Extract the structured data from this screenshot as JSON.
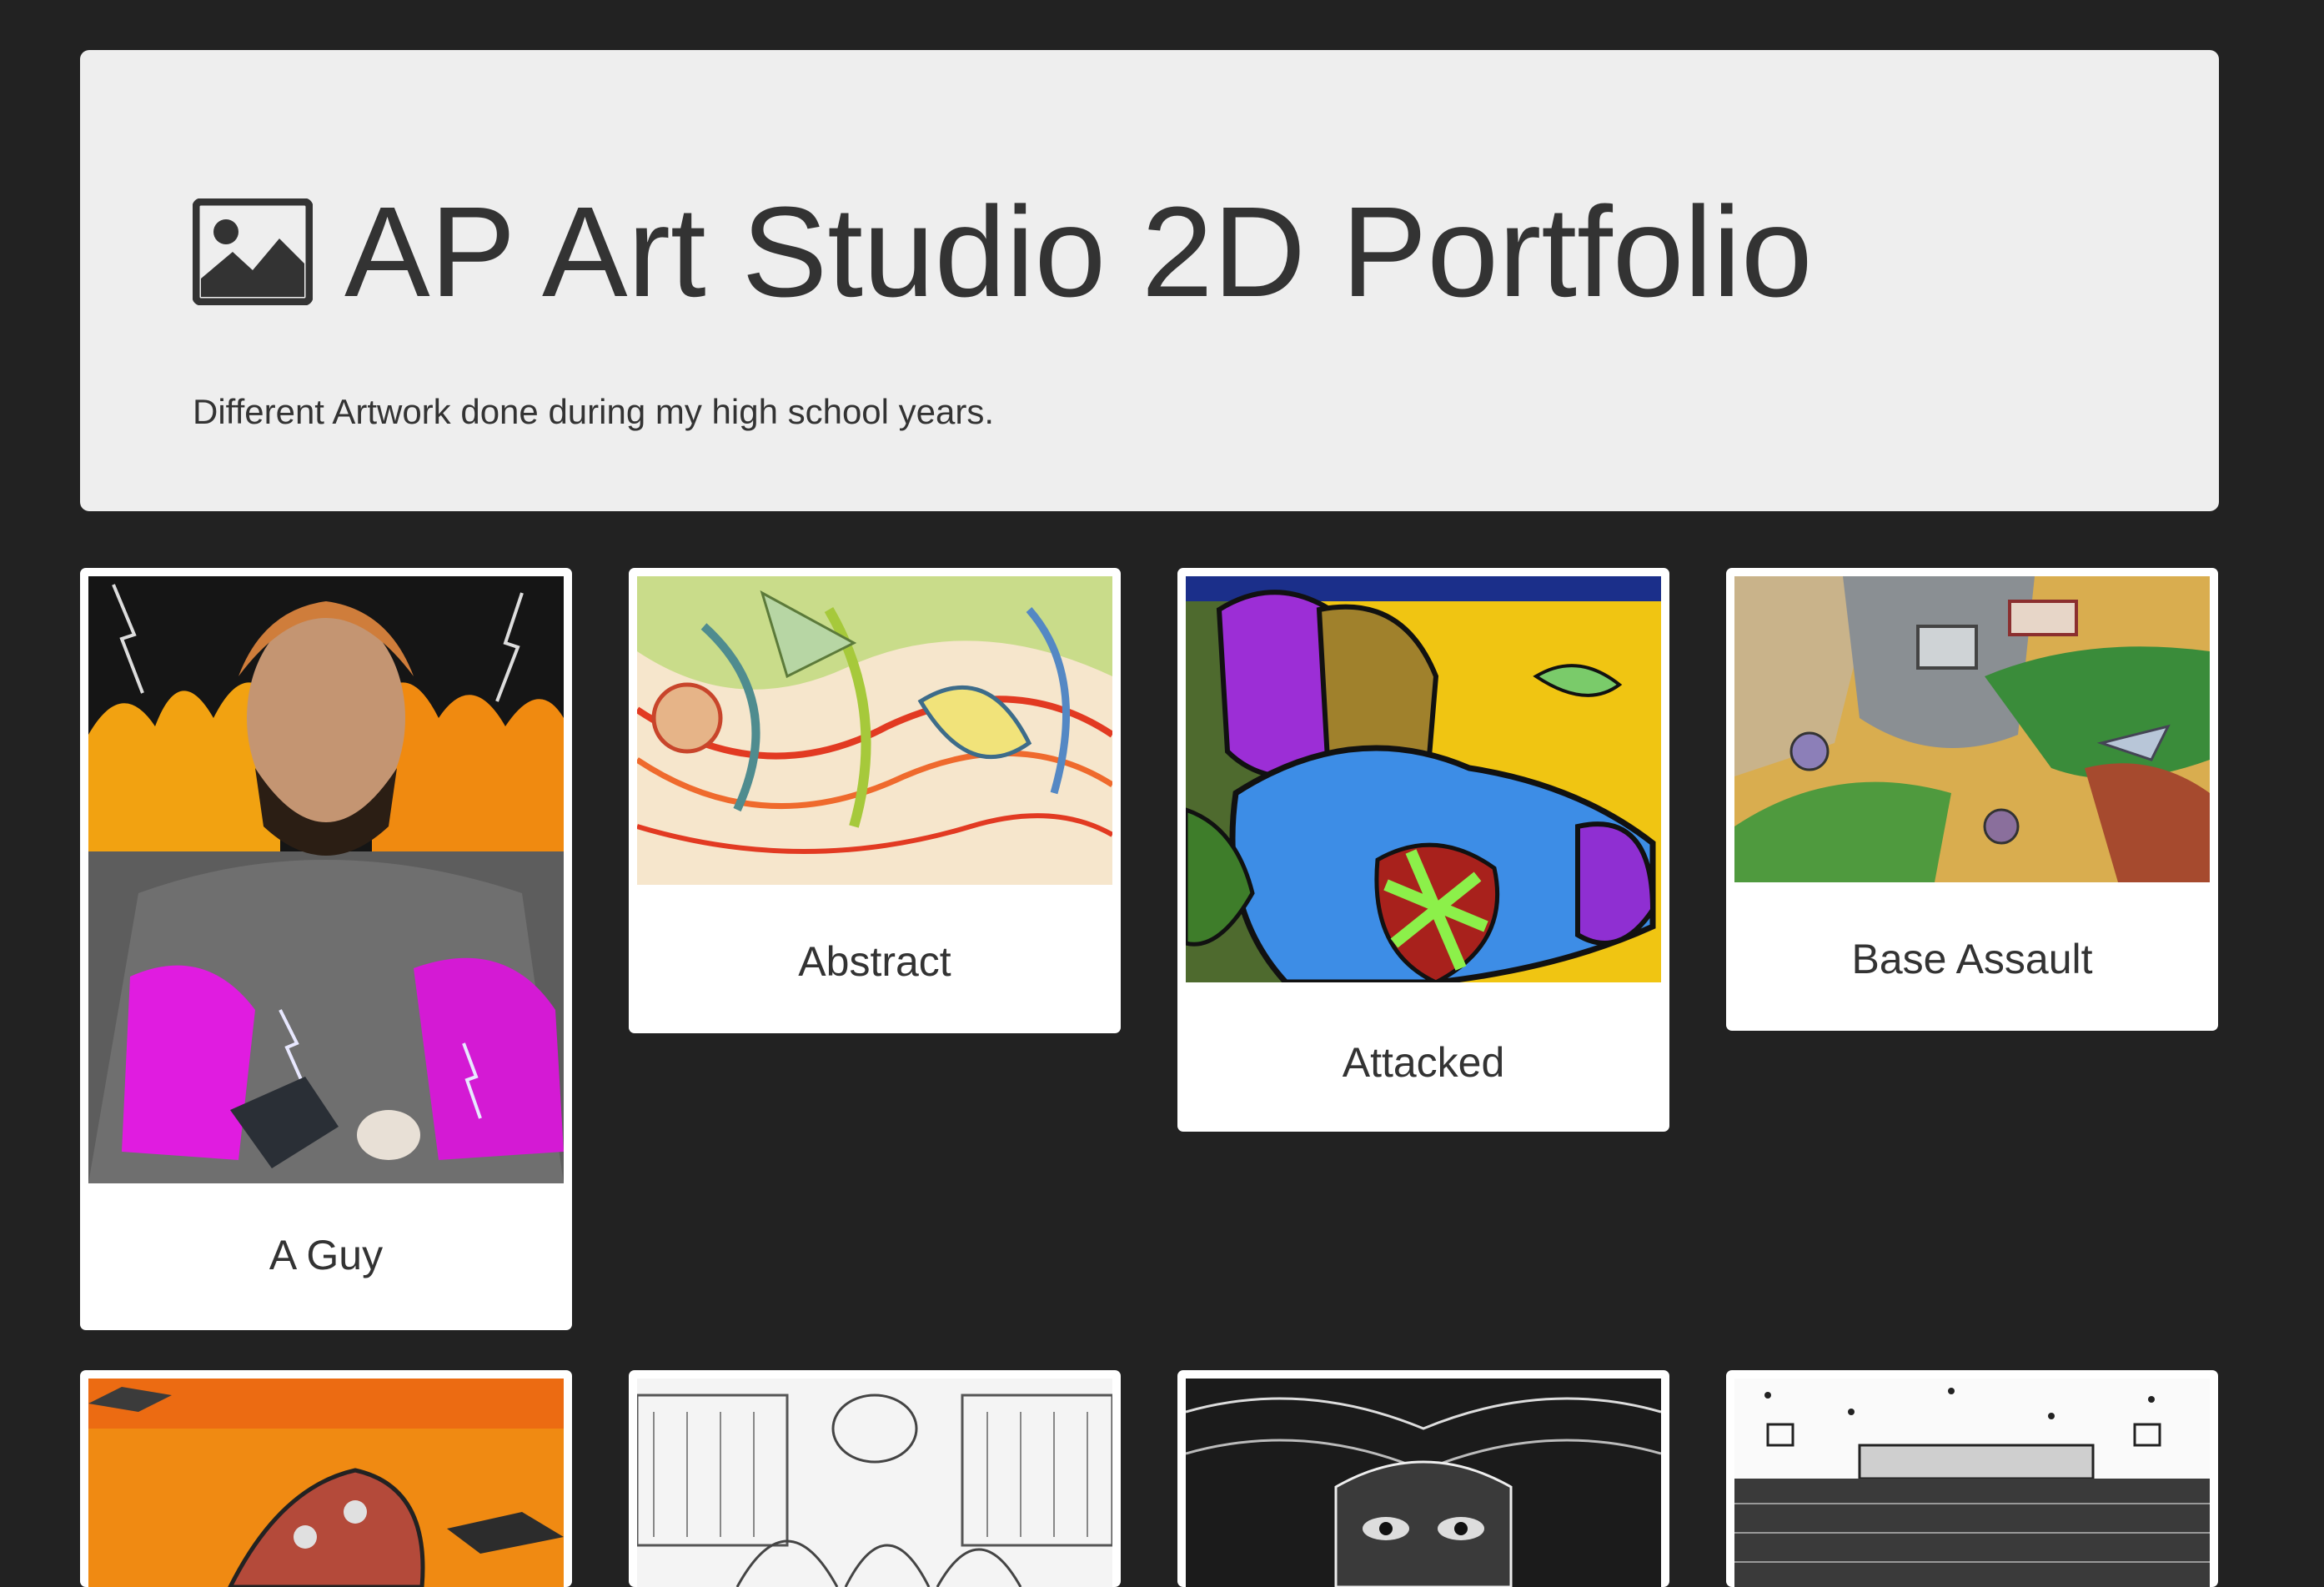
{
  "header": {
    "icon": "image-icon",
    "title": "AP Art Studio 2D Portfolio",
    "subtitle": "Different Artwork done during my high school years."
  },
  "gallery": {
    "items": [
      {
        "caption": "A Guy"
      },
      {
        "caption": "Abstract"
      },
      {
        "caption": "Attacked"
      },
      {
        "caption": "Base Assault"
      },
      {
        "caption": ""
      },
      {
        "caption": ""
      },
      {
        "caption": ""
      },
      {
        "caption": ""
      }
    ]
  },
  "colors": {
    "page_background": "#222222",
    "jumbotron_background": "#eeeeee",
    "card_background": "#ffffff",
    "text": "#333333"
  }
}
